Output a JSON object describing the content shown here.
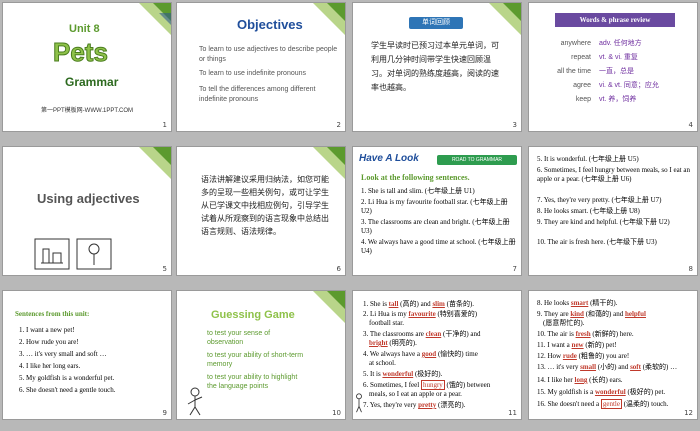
{
  "slides": [
    {
      "num": "1",
      "unit": "Unit 8",
      "title": "Pets",
      "sub": "Grammar",
      "footer": "第一PPT模板网-WWW.1PPT.COM"
    },
    {
      "num": "2",
      "title": "Objectives",
      "items": [
        "To learn to use adjectives to describe people or things",
        "To learn to use indefinite pronouns",
        "To tell the differences among different indefinite pronouns"
      ]
    },
    {
      "num": "3",
      "banner": "单词回顾",
      "text": "学生早读时已预习过本单元单词，可利用几分钟时间带学生快速回顾温习。对单词的熟练度越高，阅读的速率也越高。"
    },
    {
      "num": "4",
      "banner": "Words & phrase review",
      "rows": [
        [
          "anywhere",
          "adv. 任何地方"
        ],
        [
          "repeat",
          "vt. & vi. 重复"
        ],
        [
          "all the time",
          "一直，总是"
        ],
        [
          "agree",
          "vi. & vt. 同意；应允"
        ],
        [
          "keep",
          "vt. 养，饲养"
        ]
      ]
    },
    {
      "num": "5",
      "title": "Using adjectives"
    },
    {
      "num": "6",
      "text": "语法讲解建议采用归纳法，如您可能多的呈现一些相关例句，或可让学生从已学课文中找相应例句，引导学生试着从所观察到的语言现象中总结出语言规则、语法规律。"
    },
    {
      "num": "7",
      "title": "Have A Look",
      "road": "ROAD TO GRAMMAR",
      "lead": "Look at the following sentences.",
      "items": [
        "1. She is tall and slim. (七年级上册 U1)",
        "2. Li Hua is my favourite football star. (七年级上册 U2)",
        "3. The classrooms are clean and bright. (七年级上册 U3)",
        "4. We always have a good time at school. (七年级上册 U4)"
      ]
    },
    {
      "num": "8",
      "items": [
        "5. It is wonderful. (七年级上册 U5)",
        "6. Sometimes, I feel hungry between meals, so I eat an apple or a pear. (七年级上册 U6)",
        "7. Yes, they're very pretty. (七年级上册 U7)",
        "8. He looks smart. (七年级上册 U8)",
        "9. They are kind and helpful. (七年级下册 U2)",
        "10. The air is fresh here. (七年级下册 U3)"
      ]
    },
    {
      "num": "9",
      "lead": "Sentences from this unit:",
      "items": [
        "1. I want a new pet!",
        "2. How rude you are!",
        "3. … it's very small and soft …",
        "4. I like her long ears.",
        "5. My goldfish is a wonderful pet.",
        "6. She doesn't need a gentle touch."
      ]
    },
    {
      "num": "10",
      "title": "Guessing Game",
      "items": [
        "to test your sense of observation",
        "to test your ability of short-term memory",
        "to test your ability to highlight the language points"
      ]
    },
    {
      "num": "11"
    },
    {
      "num": "12"
    }
  ],
  "s11": {
    "l1a": "1. She is",
    "w1": "tall",
    "l1b": "(高的) and",
    "w2": "slim",
    "l1c": "(苗条的).",
    "l2a": "2. Li Hua is my",
    "w3": "favourite",
    "l2b": "(特别喜爱的)",
    "l2c": "football star.",
    "l3a": "3. The classrooms are",
    "w4": "clean",
    "l3b": "(干净的) and",
    "w5": "bright",
    "l3c": "(明亮的).",
    "l4a": "4. We always have a",
    "w6": "good",
    "l4b": "(愉快的) time",
    "l4c": "at school.",
    "l5a": "5. It is",
    "w7": "wonderful",
    "l5b": "(极好的).",
    "l6a": "6. Sometimes, I feel",
    "w8": "hungry",
    "l6b": "(饿的) between",
    "l6c": "meals, so I eat an apple or a pear.",
    "l7a": "7. Yes, they're very",
    "w9": "pretty",
    "l7b": "(漂亮的)."
  },
  "s12": {
    "l1a": "8. He looks",
    "w1": "smart",
    "l1b": "(精干的).",
    "l2a": "9. They are",
    "w2": "kind",
    "l2b": "(和蔼的) and",
    "w3": "helpful",
    "l2c": "(愿意帮忙的).",
    "l3a": "10. The air is",
    "w4": "fresh",
    "l3b": "(新鲜的) here.",
    "l4a": "11. I want a",
    "w5": "new",
    "l4b": "(新的) pet!",
    "l5a": "12. How",
    "w6": "rude",
    "l5b": "(粗鲁的) you are!",
    "l6a": "13. … it's very",
    "w7": "small",
    "l6b": "(小的) and",
    "w8": "soft",
    "l6c": "(柔软的) …",
    "l7a": "14. I like her",
    "w9": "long",
    "l7b": "(长的) ears.",
    "l8a": "15. My goldfish is a",
    "w10": "wonderful",
    "l8b": "(极好的) pet.",
    "l9a": "16. She doesn't need a",
    "w11": "gentle",
    "l9b": "(温柔的) touch."
  },
  "colors": {
    "green": "#5c9a2e",
    "darkgreen": "#2d6a1f",
    "blue": "#1f4e9b",
    "red": "#c0392b",
    "purple": "#7030a0",
    "gray": "#7a7a7a"
  }
}
